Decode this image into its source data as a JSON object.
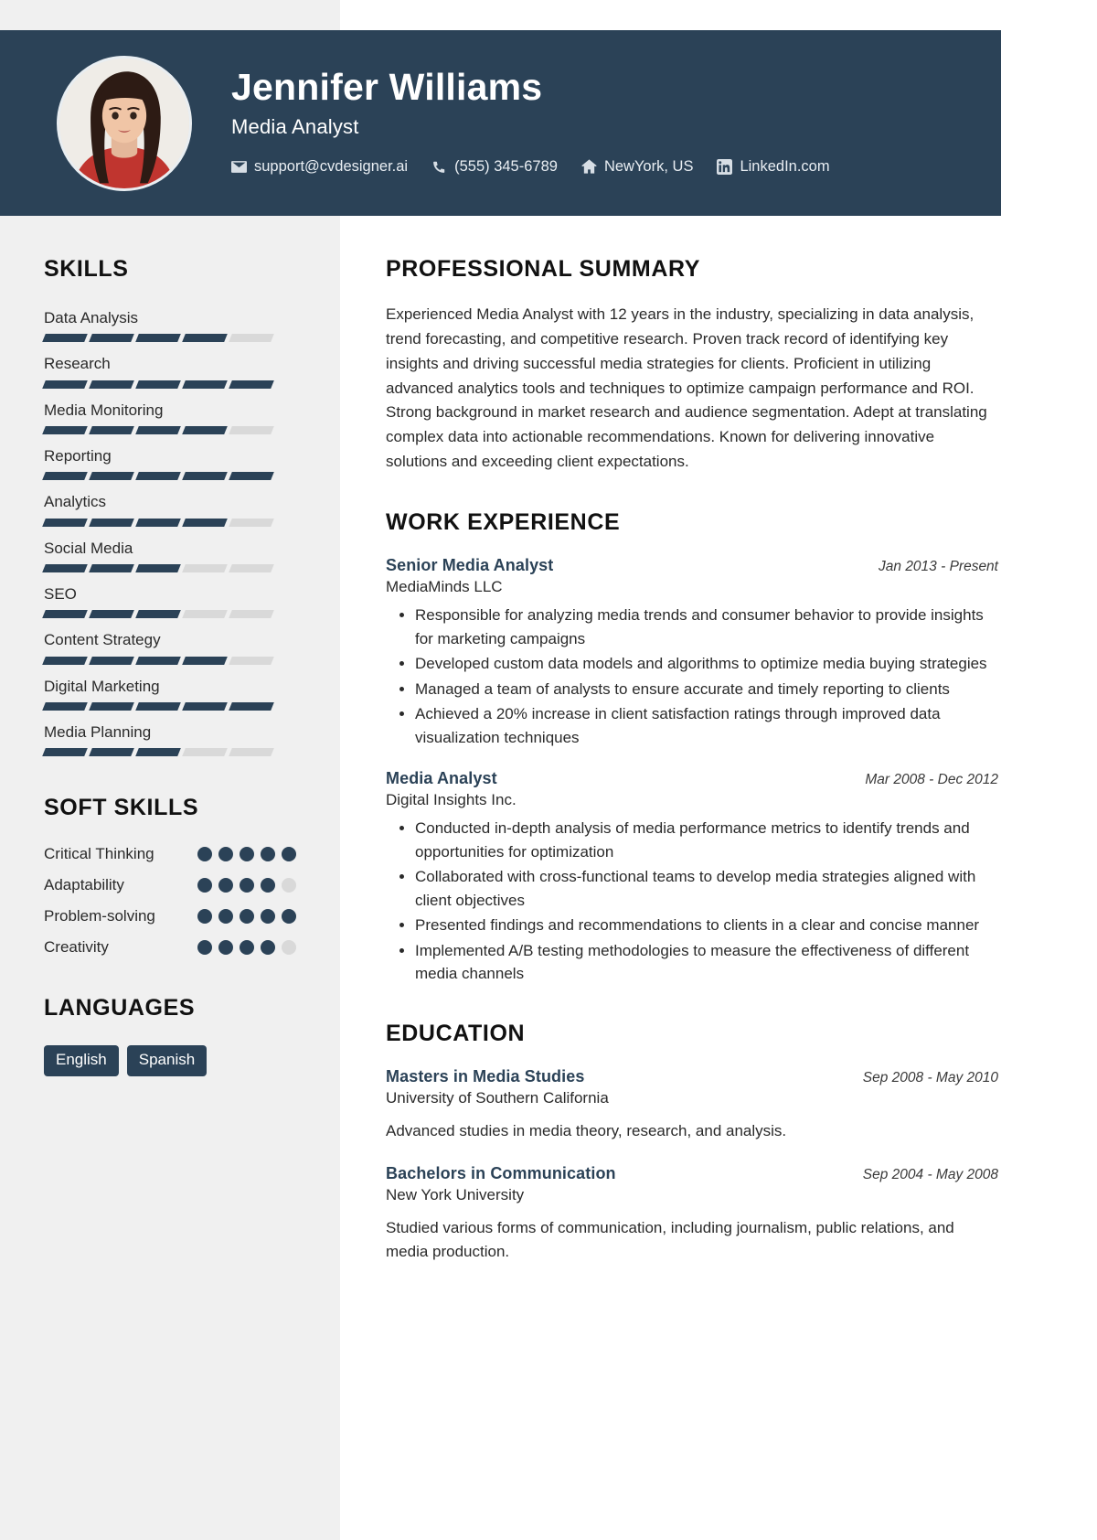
{
  "theme": {
    "accent": "#2b4257",
    "sidebar_bg": "#f0f0f0",
    "bar_empty": "#d9d9d9",
    "page_bg": "#ffffff"
  },
  "header": {
    "name": "Jennifer Williams",
    "role": "Media Analyst",
    "contacts": [
      {
        "icon": "envelope-icon",
        "label": "support@cvdesigner.ai"
      },
      {
        "icon": "phone-icon",
        "label": "(555) 345-6789"
      },
      {
        "icon": "home-icon",
        "label": "NewYork, US"
      },
      {
        "icon": "linkedin-icon",
        "label": "LinkedIn.com"
      }
    ]
  },
  "sidebar": {
    "skills_title": "SKILLS",
    "skills": [
      {
        "name": "Data Analysis",
        "level": 4,
        "max": 5
      },
      {
        "name": "Research",
        "level": 5,
        "max": 5
      },
      {
        "name": "Media Monitoring",
        "level": 4,
        "max": 5
      },
      {
        "name": "Reporting",
        "level": 5,
        "max": 5
      },
      {
        "name": "Analytics",
        "level": 4,
        "max": 5
      },
      {
        "name": "Social Media",
        "level": 3,
        "max": 5
      },
      {
        "name": "SEO",
        "level": 3,
        "max": 5
      },
      {
        "name": "Content Strategy",
        "level": 4,
        "max": 5
      },
      {
        "name": "Digital Marketing",
        "level": 5,
        "max": 5
      },
      {
        "name": "Media Planning",
        "level": 3,
        "max": 5
      }
    ],
    "soft_skills_title": "SOFT SKILLS",
    "soft_skills": [
      {
        "name": "Critical Thinking",
        "level": 5,
        "max": 5
      },
      {
        "name": "Adaptability",
        "level": 4,
        "max": 5
      },
      {
        "name": "Problem-solving",
        "level": 5,
        "max": 5
      },
      {
        "name": "Creativity",
        "level": 4,
        "max": 5
      }
    ],
    "languages_title": "LANGUAGES",
    "languages": [
      "English",
      "Spanish"
    ]
  },
  "main": {
    "summary_title": "PROFESSIONAL SUMMARY",
    "summary_text": "Experienced Media Analyst with 12 years in the industry, specializing in data analysis, trend forecasting, and competitive research. Proven track record of identifying key insights and driving successful media strategies for clients. Proficient in utilizing advanced analytics tools and techniques to optimize campaign performance and ROI. Strong background in market research and audience segmentation. Adept at translating complex data into actionable recommendations. Known for delivering innovative solutions and exceeding client expectations.",
    "experience_title": "WORK EXPERIENCE",
    "experience": [
      {
        "title": "Senior Media Analyst",
        "company": "MediaMinds LLC",
        "date": "Jan 2013 - Present",
        "bullets": [
          "Responsible for analyzing media trends and consumer behavior to provide insights for marketing campaigns",
          "Developed custom data models and algorithms to optimize media buying strategies",
          "Managed a team of analysts to ensure accurate and timely reporting to clients",
          "Achieved a 20% increase in client satisfaction ratings through improved data visualization techniques"
        ]
      },
      {
        "title": "Media Analyst",
        "company": "Digital Insights Inc.",
        "date": "Mar 2008 - Dec 2012",
        "bullets": [
          "Conducted in-depth analysis of media performance metrics to identify trends and opportunities for optimization",
          "Collaborated with cross-functional teams to develop media strategies aligned with client objectives",
          "Presented findings and recommendations to clients in a clear and concise manner",
          "Implemented A/B testing methodologies to measure the effectiveness of different media channels"
        ]
      }
    ],
    "education_title": "EDUCATION",
    "education": [
      {
        "degree": "Masters in Media Studies",
        "school": "University of Southern California",
        "date": "Sep 2008 - May 2010",
        "description": "Advanced studies in media theory, research, and analysis."
      },
      {
        "degree": "Bachelors in Communication",
        "school": "New York University",
        "date": "Sep 2004 - May 2008",
        "description": "Studied various forms of communication, including journalism, public relations, and media production."
      }
    ]
  }
}
